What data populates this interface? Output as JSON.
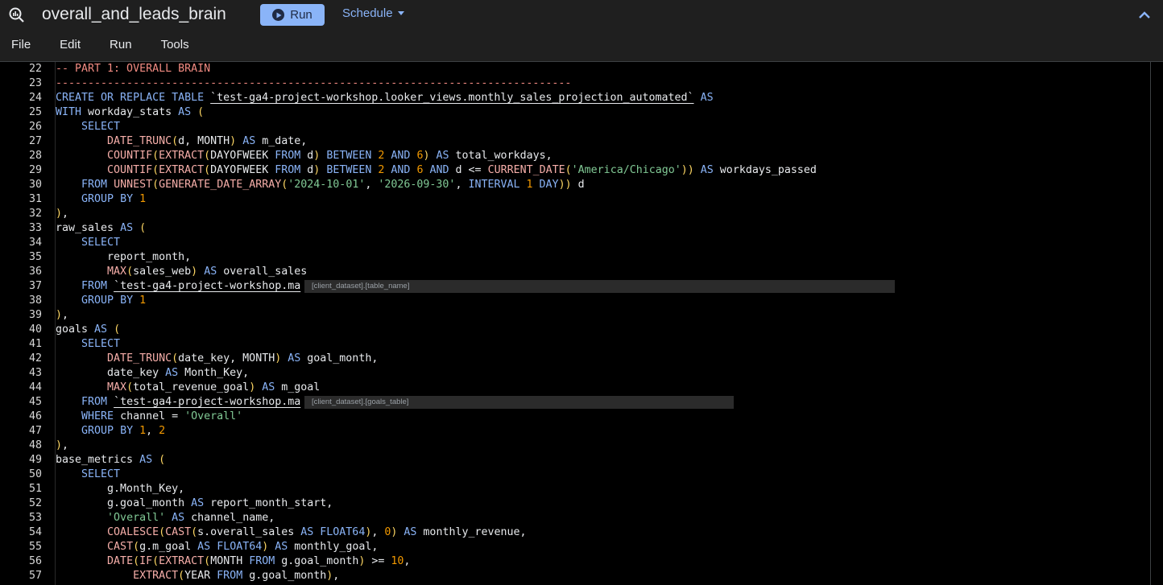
{
  "header": {
    "query_name": "overall_and_leads_brain",
    "run_label": "Run",
    "schedule_label": "Schedule",
    "menu": [
      "File",
      "Edit",
      "Run",
      "Tools"
    ]
  },
  "editor": {
    "lines": [
      {
        "n": "22",
        "t": [
          [
            "c",
            "-- PART 1: OVERALL BRAIN"
          ]
        ]
      },
      {
        "n": "23",
        "t": [
          [
            "c",
            "--------------------------------------------------------------------------------"
          ]
        ]
      },
      {
        "n": "24",
        "t": [
          [
            "k",
            "CREATE OR REPLACE TABLE "
          ],
          [
            "u",
            "`test-ga4-project-workshop.looker_views.monthly_sales_projection_automated`"
          ],
          [
            "p",
            " "
          ],
          [
            "k",
            "AS"
          ]
        ]
      },
      {
        "n": "25",
        "t": [
          [
            "k",
            "WITH "
          ],
          [
            "p",
            "workday_stats "
          ],
          [
            "k",
            "AS "
          ],
          [
            "y",
            "("
          ]
        ]
      },
      {
        "n": "26",
        "t": [
          [
            "p",
            "    "
          ],
          [
            "k",
            "SELECT"
          ]
        ]
      },
      {
        "n": "27",
        "t": [
          [
            "p",
            "        "
          ],
          [
            "f",
            "DATE_TRUNC"
          ],
          [
            "y",
            "("
          ],
          [
            "p",
            "d, MONTH"
          ],
          [
            "y",
            ")"
          ],
          [
            "p",
            " "
          ],
          [
            "k",
            "AS"
          ],
          [
            "p",
            " m_date,"
          ]
        ]
      },
      {
        "n": "28",
        "t": [
          [
            "p",
            "        "
          ],
          [
            "f",
            "COUNTIF"
          ],
          [
            "y",
            "("
          ],
          [
            "f",
            "EXTRACT"
          ],
          [
            "y",
            "("
          ],
          [
            "p",
            "DAYOFWEEK "
          ],
          [
            "k",
            "FROM"
          ],
          [
            "p",
            " d"
          ],
          [
            "y",
            ")"
          ],
          [
            "p",
            " "
          ],
          [
            "k",
            "BETWEEN"
          ],
          [
            "p",
            " "
          ],
          [
            "n",
            "2"
          ],
          [
            "p",
            " "
          ],
          [
            "k",
            "AND"
          ],
          [
            "p",
            " "
          ],
          [
            "n",
            "6"
          ],
          [
            "y",
            ")"
          ],
          [
            "p",
            " "
          ],
          [
            "k",
            "AS"
          ],
          [
            "p",
            " total_workdays,"
          ]
        ]
      },
      {
        "n": "29",
        "t": [
          [
            "p",
            "        "
          ],
          [
            "f",
            "COUNTIF"
          ],
          [
            "y",
            "("
          ],
          [
            "f",
            "EXTRACT"
          ],
          [
            "y",
            "("
          ],
          [
            "p",
            "DAYOFWEEK "
          ],
          [
            "k",
            "FROM"
          ],
          [
            "p",
            " d"
          ],
          [
            "y",
            ")"
          ],
          [
            "p",
            " "
          ],
          [
            "k",
            "BETWEEN"
          ],
          [
            "p",
            " "
          ],
          [
            "n",
            "2"
          ],
          [
            "p",
            " "
          ],
          [
            "k",
            "AND"
          ],
          [
            "p",
            " "
          ],
          [
            "n",
            "6"
          ],
          [
            "p",
            " "
          ],
          [
            "k",
            "AND"
          ],
          [
            "p",
            " d <= "
          ],
          [
            "f",
            "CURRENT_DATE"
          ],
          [
            "y",
            "("
          ],
          [
            "s",
            "'America/Chicago'"
          ],
          [
            "y",
            "))"
          ],
          [
            "p",
            " "
          ],
          [
            "k",
            "AS"
          ],
          [
            "p",
            " workdays_passed"
          ]
        ]
      },
      {
        "n": "30",
        "t": [
          [
            "p",
            "    "
          ],
          [
            "k",
            "FROM"
          ],
          [
            "p",
            " "
          ],
          [
            "f",
            "UNNEST"
          ],
          [
            "y",
            "("
          ],
          [
            "f",
            "GENERATE_DATE_ARRAY"
          ],
          [
            "y",
            "("
          ],
          [
            "s",
            "'2024-10-01'"
          ],
          [
            "p",
            ", "
          ],
          [
            "s",
            "'2026-09-30'"
          ],
          [
            "p",
            ", "
          ],
          [
            "k",
            "INTERVAL"
          ],
          [
            "p",
            " "
          ],
          [
            "n",
            "1"
          ],
          [
            "p",
            " "
          ],
          [
            "k",
            "DAY"
          ],
          [
            "y",
            "))"
          ],
          [
            "p",
            " d"
          ]
        ]
      },
      {
        "n": "31",
        "t": [
          [
            "p",
            "    "
          ],
          [
            "k",
            "GROUP BY"
          ],
          [
            "p",
            " "
          ],
          [
            "n",
            "1"
          ]
        ]
      },
      {
        "n": "32",
        "t": [
          [
            "y",
            ")"
          ],
          [
            "p",
            ","
          ]
        ]
      },
      {
        "n": "33",
        "t": [
          [
            "p",
            "raw_sales "
          ],
          [
            "k",
            "AS"
          ],
          [
            "p",
            " "
          ],
          [
            "y",
            "("
          ]
        ]
      },
      {
        "n": "34",
        "t": [
          [
            "p",
            "    "
          ],
          [
            "k",
            "SELECT"
          ]
        ]
      },
      {
        "n": "35",
        "t": [
          [
            "p",
            "        report_month,"
          ]
        ]
      },
      {
        "n": "36",
        "t": [
          [
            "p",
            "        "
          ],
          [
            "f",
            "MAX"
          ],
          [
            "y",
            "("
          ],
          [
            "p",
            "sales_web"
          ],
          [
            "y",
            ")"
          ],
          [
            "p",
            " "
          ],
          [
            "k",
            "AS"
          ],
          [
            "p",
            " overall_sales"
          ]
        ]
      },
      {
        "n": "37",
        "t": [
          [
            "p",
            "    "
          ],
          [
            "k",
            "FROM"
          ],
          [
            "p",
            " "
          ],
          [
            "u",
            "`test-ga4-project-workshop.ma"
          ]
        ]
      },
      {
        "n": "38",
        "t": [
          [
            "p",
            "    "
          ],
          [
            "k",
            "GROUP BY"
          ],
          [
            "p",
            " "
          ],
          [
            "n",
            "1"
          ]
        ]
      },
      {
        "n": "39",
        "t": [
          [
            "y",
            ")"
          ],
          [
            "p",
            ","
          ]
        ]
      },
      {
        "n": "40",
        "t": [
          [
            "p",
            "goals "
          ],
          [
            "k",
            "AS"
          ],
          [
            "p",
            " "
          ],
          [
            "y",
            "("
          ]
        ]
      },
      {
        "n": "41",
        "t": [
          [
            "p",
            "    "
          ],
          [
            "k",
            "SELECT"
          ]
        ]
      },
      {
        "n": "42",
        "t": [
          [
            "p",
            "        "
          ],
          [
            "f",
            "DATE_TRUNC"
          ],
          [
            "y",
            "("
          ],
          [
            "p",
            "date_key, MONTH"
          ],
          [
            "y",
            ")"
          ],
          [
            "p",
            " "
          ],
          [
            "k",
            "AS"
          ],
          [
            "p",
            " goal_month,"
          ]
        ]
      },
      {
        "n": "43",
        "t": [
          [
            "p",
            "        date_key "
          ],
          [
            "k",
            "AS"
          ],
          [
            "p",
            " Month_Key,"
          ]
        ]
      },
      {
        "n": "44",
        "t": [
          [
            "p",
            "        "
          ],
          [
            "f",
            "MAX"
          ],
          [
            "y",
            "("
          ],
          [
            "p",
            "total_revenue_goal"
          ],
          [
            "y",
            ")"
          ],
          [
            "p",
            " "
          ],
          [
            "k",
            "AS"
          ],
          [
            "p",
            " m_goal"
          ]
        ]
      },
      {
        "n": "45",
        "t": [
          [
            "p",
            "    "
          ],
          [
            "k",
            "FROM"
          ],
          [
            "p",
            " "
          ],
          [
            "u",
            "`test-ga4-project-workshop.ma"
          ]
        ]
      },
      {
        "n": "46",
        "t": [
          [
            "p",
            "    "
          ],
          [
            "k",
            "WHERE"
          ],
          [
            "p",
            " channel = "
          ],
          [
            "s",
            "'Overall'"
          ]
        ]
      },
      {
        "n": "47",
        "t": [
          [
            "p",
            "    "
          ],
          [
            "k",
            "GROUP BY"
          ],
          [
            "p",
            " "
          ],
          [
            "n",
            "1"
          ],
          [
            "p",
            ", "
          ],
          [
            "n",
            "2"
          ]
        ]
      },
      {
        "n": "48",
        "t": [
          [
            "y",
            ")"
          ],
          [
            "p",
            ","
          ]
        ]
      },
      {
        "n": "49",
        "t": [
          [
            "p",
            "base_metrics "
          ],
          [
            "k",
            "AS"
          ],
          [
            "p",
            " "
          ],
          [
            "y",
            "("
          ]
        ]
      },
      {
        "n": "50",
        "t": [
          [
            "p",
            "    "
          ],
          [
            "k",
            "SELECT"
          ]
        ]
      },
      {
        "n": "51",
        "t": [
          [
            "p",
            "        g.Month_Key,"
          ]
        ]
      },
      {
        "n": "52",
        "t": [
          [
            "p",
            "        g.goal_month "
          ],
          [
            "k",
            "AS"
          ],
          [
            "p",
            " report_month_start,"
          ]
        ]
      },
      {
        "n": "53",
        "t": [
          [
            "p",
            "        "
          ],
          [
            "s",
            "'Overall'"
          ],
          [
            "p",
            " "
          ],
          [
            "k",
            "AS"
          ],
          [
            "p",
            " channel_name,"
          ]
        ]
      },
      {
        "n": "54",
        "t": [
          [
            "p",
            "        "
          ],
          [
            "f",
            "COALESCE"
          ],
          [
            "y",
            "("
          ],
          [
            "f",
            "CAST"
          ],
          [
            "y",
            "("
          ],
          [
            "p",
            "s.overall_sales "
          ],
          [
            "k",
            "AS"
          ],
          [
            "p",
            " "
          ],
          [
            "k",
            "FLOAT64"
          ],
          [
            "y",
            ")"
          ],
          [
            "p",
            ", "
          ],
          [
            "n",
            "0"
          ],
          [
            "y",
            ")"
          ],
          [
            "p",
            " "
          ],
          [
            "k",
            "AS"
          ],
          [
            "p",
            " monthly_revenue,"
          ]
        ]
      },
      {
        "n": "55",
        "t": [
          [
            "p",
            "        "
          ],
          [
            "f",
            "CAST"
          ],
          [
            "y",
            "("
          ],
          [
            "p",
            "g.m_goal "
          ],
          [
            "k",
            "AS"
          ],
          [
            "p",
            " "
          ],
          [
            "k",
            "FLOAT64"
          ],
          [
            "y",
            ")"
          ],
          [
            "p",
            " "
          ],
          [
            "k",
            "AS"
          ],
          [
            "p",
            " monthly_goal,"
          ]
        ]
      },
      {
        "n": "56",
        "t": [
          [
            "p",
            "        "
          ],
          [
            "f",
            "DATE"
          ],
          [
            "y",
            "("
          ],
          [
            "f",
            "IF"
          ],
          [
            "y",
            "("
          ],
          [
            "f",
            "EXTRACT"
          ],
          [
            "y",
            "("
          ],
          [
            "p",
            "MONTH "
          ],
          [
            "k",
            "FROM"
          ],
          [
            "p",
            " g.goal_month"
          ],
          [
            "y",
            ")"
          ],
          [
            "p",
            " >= "
          ],
          [
            "n",
            "10"
          ],
          [
            "p",
            ","
          ]
        ]
      },
      {
        "n": "57",
        "t": [
          [
            "p",
            "            "
          ],
          [
            "f",
            "EXTRACT"
          ],
          [
            "y",
            "("
          ],
          [
            "p",
            "YEAR "
          ],
          [
            "k",
            "FROM"
          ],
          [
            "p",
            " g.goal_month"
          ],
          [
            "y",
            ")"
          ],
          [
            "p",
            ","
          ]
        ]
      }
    ],
    "tooltips": [
      {
        "line": "37",
        "text": "[client_dataset].[table_name]"
      },
      {
        "line": "45",
        "text": "[client_dataset].[goals_table]"
      }
    ]
  }
}
